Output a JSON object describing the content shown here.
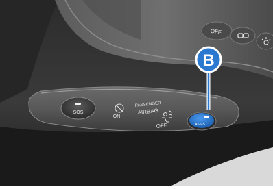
{
  "callout": {
    "letter": "B"
  },
  "console": {
    "sos_label": "SOS",
    "passenger_airbag": {
      "line1": "PASSENGER",
      "line2": "AIRBAG",
      "on_label": "ON",
      "off_label": "OFF"
    },
    "assist_label": "ASSIST"
  },
  "lamp_panel": {
    "off_label": "OFF"
  },
  "colors": {
    "assist_button": "#2a78d0",
    "callout_fill": "#2a78d0",
    "panel_dark": "#2a2a2b",
    "panel_light": "#7f7f80"
  }
}
